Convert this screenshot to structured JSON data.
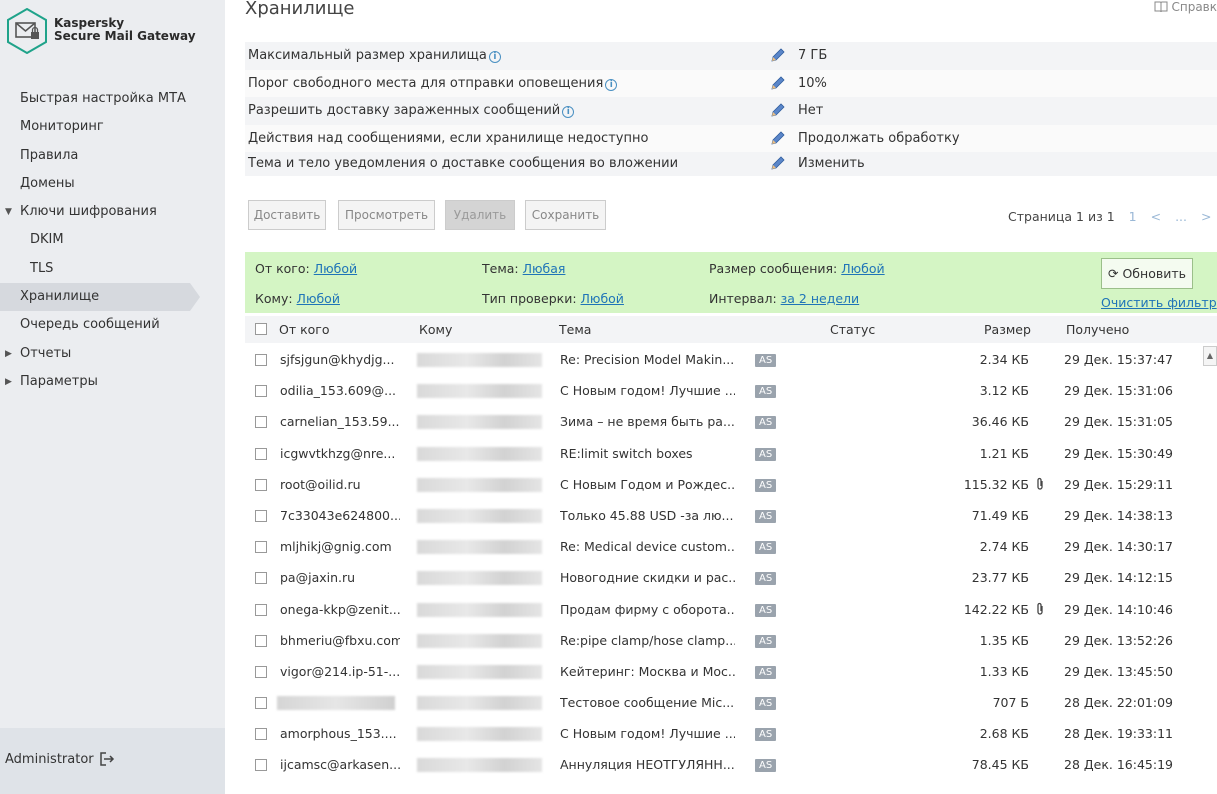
{
  "app": {
    "product_line1": "Kaspersky",
    "product_line2": "Secure Mail Gateway"
  },
  "sidebar": {
    "items": [
      {
        "label": "Быстрая настройка МТА"
      },
      {
        "label": "Мониторинг"
      },
      {
        "label": "Правила"
      },
      {
        "label": "Домены"
      },
      {
        "label": "Ключи шифрования"
      },
      {
        "label": "DKIM"
      },
      {
        "label": "TLS"
      },
      {
        "label": "Хранилище"
      },
      {
        "label": "Очередь сообщений"
      },
      {
        "label": "Отчеты"
      },
      {
        "label": "Параметры"
      }
    ],
    "user": "Administrator"
  },
  "page": {
    "title": "Хранилище",
    "help": "Справк"
  },
  "settings": [
    {
      "label": "Максимальный размер хранилища",
      "value": "7 ГБ",
      "info": true
    },
    {
      "label": "Порог свободного места для отправки оповещения",
      "value": "10%",
      "info": true
    },
    {
      "label": "Разрешить доставку зараженных сообщений",
      "value": "Нет",
      "info": true
    },
    {
      "label": "Действия над сообщениями, если хранилище недоступно",
      "value": "Продолжать обработку",
      "info": false
    },
    {
      "label": "Тема и тело уведомления о доставке сообщения во вложении",
      "value": "Изменить",
      "info": false
    }
  ],
  "toolbar": {
    "deliver": "Доставить",
    "view": "Просмотреть",
    "delete": "Удалить",
    "save": "Сохранить"
  },
  "pager": {
    "text": "Страница 1 из 1",
    "first": "1",
    "prev": "<",
    "dots": "...",
    "next": ">",
    "last": "1"
  },
  "filter": {
    "from_label": "От кого:",
    "from_value": "Любой",
    "subject_label": "Тема:",
    "subject_value": "Любая",
    "size_label": "Размер сообщения:",
    "size_value": "Любой",
    "to_label": "Кому:",
    "to_value": "Любой",
    "check_label": "Тип проверки:",
    "check_value": "Любой",
    "interval_label": "Интервал:",
    "interval_value": "за 2 недели",
    "refresh": "Обновить",
    "clear": "Очистить фильтр"
  },
  "table": {
    "headers": {
      "from": "От кого",
      "to": "Кому",
      "subject": "Тема",
      "status": "Статус",
      "size": "Размер",
      "received": "Получено"
    },
    "rows": [
      {
        "from": "sjfsjgun@khydjg...",
        "subject": "Re: Precision Model Makin...",
        "status": "AS",
        "size": "2.34 КБ",
        "clip": false,
        "date": "29 Дек. 15:37:47"
      },
      {
        "from": "odilia_153.609@...",
        "subject": "С Новым годом! Лучшие ...",
        "status": "AS",
        "size": "3.12 КБ",
        "clip": false,
        "date": "29 Дек. 15:31:06"
      },
      {
        "from": "carnelian_153.59...",
        "subject": "Зима – не время быть ра...",
        "status": "AS",
        "size": "36.46 КБ",
        "clip": false,
        "date": "29 Дек. 15:31:05"
      },
      {
        "from": "icgwvtkhzg@nre...",
        "subject": "RE:limit switch boxes",
        "status": "AS",
        "size": "1.21 КБ",
        "clip": false,
        "date": "29 Дек. 15:30:49"
      },
      {
        "from": "root@oilid.ru",
        "subject": "С Новым Годом и Рождес...",
        "status": "AS",
        "size": "115.32 КБ",
        "clip": true,
        "date": "29 Дек. 15:29:11"
      },
      {
        "from": "7c33043e624800...",
        "subject": "Только 45.88 USD -за лю...",
        "status": "AS",
        "size": "71.49 КБ",
        "clip": false,
        "date": "29 Дек. 14:38:13"
      },
      {
        "from": "mljhikj@gnig.com",
        "subject": "Re: Medical device custom...",
        "status": "AS",
        "size": "2.74 КБ",
        "clip": false,
        "date": "29 Дек. 14:30:17"
      },
      {
        "from": "pa@jaxin.ru",
        "subject": "Новогодние скидки и рас...",
        "status": "AS",
        "size": "23.77 КБ",
        "clip": false,
        "date": "29 Дек. 14:12:15"
      },
      {
        "from": "onega-kkp@zenit...",
        "subject": "Продам фирму с оборота...",
        "status": "AS",
        "size": "142.22 КБ",
        "clip": true,
        "date": "29 Дек. 14:10:46"
      },
      {
        "from": "bhmeriu@fbxu.com",
        "subject": "Re:pipe clamp/hose clamp...",
        "status": "AS",
        "size": "1.35 КБ",
        "clip": false,
        "date": "29 Дек. 13:52:26"
      },
      {
        "from": "vigor@214.ip-51-...",
        "subject": "Кейтеринг: Москва и Мос...",
        "status": "AS",
        "size": "1.33 КБ",
        "clip": false,
        "date": "29 Дек. 13:45:50"
      },
      {
        "from": "",
        "subject": "Тестовое сообщение Mic...",
        "status": "AS",
        "size": "707 Б",
        "clip": false,
        "date": "28 Дек. 22:01:09"
      },
      {
        "from": "amorphous_153....",
        "subject": "С Новым годом! Лучшие ...",
        "status": "AS",
        "size": "2.68 КБ",
        "clip": false,
        "date": "28 Дек. 19:33:11"
      },
      {
        "from": "ijcamsc@arkasen...",
        "subject": "Аннуляция НЕОТГУЛЯНН...",
        "status": "AS",
        "size": "78.45 КБ",
        "clip": false,
        "date": "28 Дек. 16:45:19"
      }
    ]
  }
}
